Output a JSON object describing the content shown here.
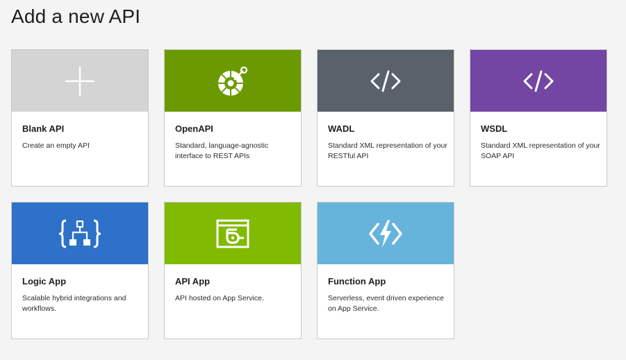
{
  "page": {
    "title": "Add a new API"
  },
  "cards": [
    {
      "title": "Blank API",
      "description": "Create an empty API",
      "icon": "plus-icon",
      "color": "#d4d4d4"
    },
    {
      "title": "OpenAPI",
      "description": "Standard, language-agnostic interface to REST APIs",
      "icon": "openapi-icon",
      "color": "#6b9a00"
    },
    {
      "title": "WADL",
      "description": "Standard XML representation of your RESTful API",
      "icon": "code-icon",
      "color": "#59626b"
    },
    {
      "title": "WSDL",
      "description": "Standard XML representation of your SOAP API",
      "icon": "code-icon",
      "color": "#7446a4"
    },
    {
      "title": "Logic App",
      "description": "Scalable hybrid integrations and workflows.",
      "icon": "logic-app-icon",
      "color": "#2d72c8"
    },
    {
      "title": "API App",
      "description": "API hosted on App Service.",
      "icon": "api-app-icon",
      "color": "#80ba01"
    },
    {
      "title": "Function App",
      "description": "Serverless, event driven experience on App Service.",
      "icon": "function-app-icon",
      "color": "#66b3dc"
    }
  ]
}
